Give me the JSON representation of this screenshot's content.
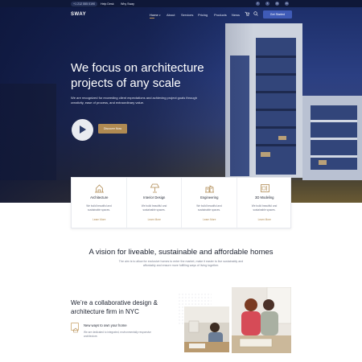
{
  "topbar": {
    "phone": "+1 212 555 0190",
    "help_label": "Help Desk",
    "why_label": "Why Sway",
    "social_icons": [
      "facebook-icon",
      "twitter-icon",
      "instagram-icon",
      "linkedin-icon"
    ]
  },
  "nav": {
    "logo": "SWAY",
    "items": [
      "Home",
      "About",
      "Services",
      "Pricing",
      "Products",
      "News"
    ],
    "cta": "Get Started",
    "accent": "#b8925a"
  },
  "hero": {
    "title_line1": "We focus on architecture",
    "title_line2": "projects of any scale",
    "description": "We are recognized for exceeding client expectations and achieving project goals through creativity, ease of process, and extraordinary value.",
    "button": "Discover Now"
  },
  "services": [
    {
      "title": "Architecture",
      "desc": "We build beautiful and sustainable spaces.",
      "link": "Learn More"
    },
    {
      "title": "Interior Design",
      "desc": "We build beautiful and sustainable spaces.",
      "link": "Learn More"
    },
    {
      "title": "Engineering",
      "desc": "We build beautiful and sustainable spaces.",
      "link": "Learn More"
    },
    {
      "title": "3D Modeling",
      "desc": "We build beautiful and sustainable spaces.",
      "link": "Learn More"
    }
  ],
  "vision": {
    "title": "A vision for liveable, sustainable and affordable homes",
    "description": "The aim is to allow for exclusive homes to enter the market, make it easier to live sustainably and affordably and ensure more fulfilling ways of living together."
  },
  "about": {
    "title_line1": "We’re a collaborative design &",
    "title_line2": "architecture firm in NYC",
    "feature_title": "New ways to own your home",
    "feature_desc": "We are dedicated to integrated, environmentally responsive architecture."
  },
  "colors": {
    "brand_dark": "#0f1838",
    "gold": "#b08a52",
    "blue_button": "#3f5bb7"
  }
}
